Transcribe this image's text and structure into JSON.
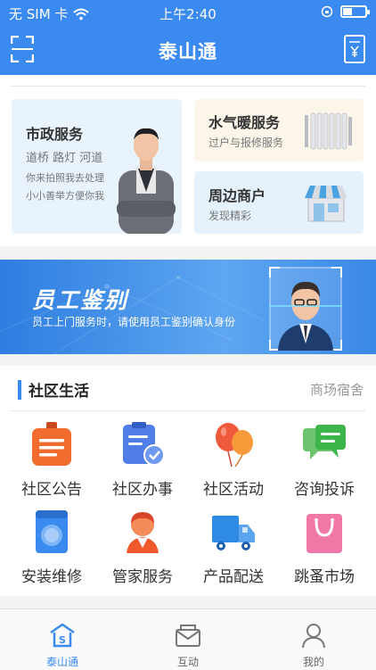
{
  "status_bar": {
    "carrier": "无 SIM 卡",
    "time": "上午2:40"
  },
  "nav": {
    "title": "泰山通",
    "scan_icon": "scan-icon",
    "wallet_icon": "wallet-icon"
  },
  "services": {
    "municipal": {
      "title": "市政服务",
      "line1": "道桥 路灯 河道",
      "line2": "你来拍照我去处理",
      "line3": "小小善举方便你我"
    },
    "water_heating": {
      "title": "水气暖服务",
      "subtitle": "过户与报修服务"
    },
    "merchants": {
      "title": "周边商户",
      "subtitle": "发现精彩"
    }
  },
  "banner": {
    "title": "员工鉴别",
    "subtitle": "员工上门服务时，请使用员工鉴别确认身份"
  },
  "community": {
    "title": "社区生活",
    "more": "商场宿舍",
    "items": [
      {
        "label": "社区公告",
        "icon": "announcement-icon",
        "color": "#f26b2f"
      },
      {
        "label": "社区办事",
        "icon": "clipboard-check-icon",
        "color": "#4f7fe6"
      },
      {
        "label": "社区活动",
        "icon": "balloons-icon",
        "color": "#f05a3c"
      },
      {
        "label": "咨询投诉",
        "icon": "chat-icon",
        "color": "#3db54a"
      },
      {
        "label": "安装维修",
        "icon": "washing-machine-icon",
        "color": "#3b8af0"
      },
      {
        "label": "管家服务",
        "icon": "butler-icon",
        "color": "#f0582e"
      },
      {
        "label": "产品配送",
        "icon": "delivery-truck-icon",
        "color": "#2f8ae6"
      },
      {
        "label": "跳蚤市场",
        "icon": "shopping-bag-icon",
        "color": "#f078a6"
      }
    ]
  },
  "tabs": [
    {
      "label": "泰山通",
      "icon": "home-icon",
      "active": true
    },
    {
      "label": "互动",
      "icon": "mail-icon",
      "active": false
    },
    {
      "label": "我的",
      "icon": "user-icon",
      "active": false
    }
  ],
  "colors": {
    "primary": "#3b8af0",
    "background": "#f2f3f5"
  }
}
